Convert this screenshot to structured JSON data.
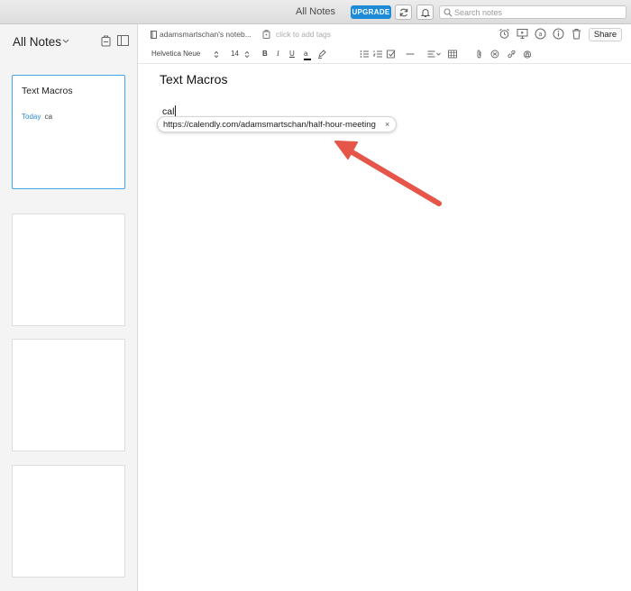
{
  "window": {
    "title": "All Notes",
    "upgrade_label": "UPGRADE",
    "search_placeholder": "Search notes"
  },
  "sidebar": {
    "title": "All Notes",
    "notes": [
      {
        "title": "Text Macros",
        "date": "Today",
        "snippet": "ca",
        "selected": true
      },
      {
        "title": "",
        "date": "",
        "snippet": "",
        "selected": false
      },
      {
        "title": "",
        "date": "",
        "snippet": "",
        "selected": false
      },
      {
        "title": "",
        "date": "",
        "snippet": "",
        "selected": false
      }
    ]
  },
  "note_header": {
    "notebook": "adamsmartschan's noteb...",
    "tags_placeholder": "click to add tags",
    "share_label": "Share",
    "icons": [
      "alarm-clock-icon",
      "present-icon",
      "amazon-icon",
      "info-icon",
      "trash-icon"
    ]
  },
  "toolbar": {
    "font": "Helvetica Neue",
    "font_size": "14",
    "icons": [
      "bold-icon",
      "italic-icon",
      "underline-icon",
      "text-color-icon",
      "highlight-icon",
      "bullet-list-icon",
      "numbered-list-icon",
      "checklist-icon",
      "horizontal-rule-icon",
      "align-icon",
      "table-icon",
      "attachment-icon",
      "code-icon",
      "link-icon",
      "lock-icon"
    ]
  },
  "editor": {
    "title": "Text Macros",
    "body": "cal",
    "suggestion": "https://calendly.com/adamsmartschan/half-hour-meeting",
    "suggestion_close": "×"
  },
  "colors": {
    "accent": "#1d8bd8",
    "date": "#2a8ad6",
    "selected_border": "#48a3e6",
    "arrow": "#e6554a"
  }
}
